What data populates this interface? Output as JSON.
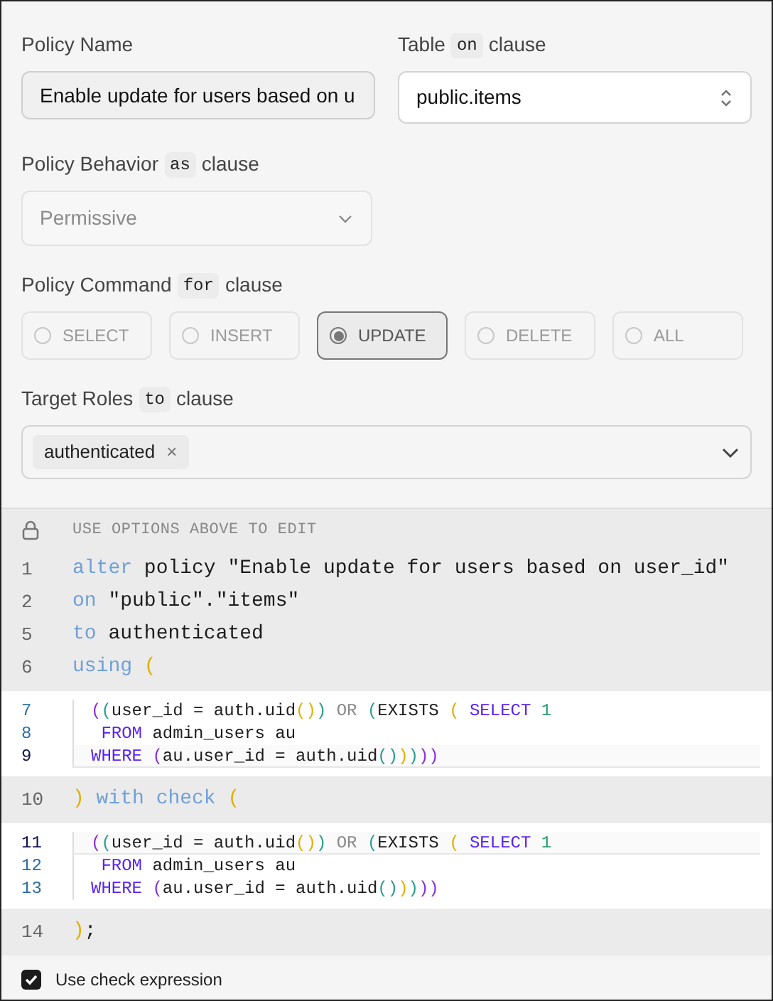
{
  "policy_name": {
    "label": "Policy Name",
    "value": "Enable update for users based on u"
  },
  "table": {
    "label": "Table",
    "keyword": "on",
    "suffix": "clause",
    "value": "public.items"
  },
  "behavior": {
    "label": "Policy Behavior",
    "keyword": "as",
    "suffix": "clause",
    "value": "Permissive",
    "disabled": true
  },
  "command": {
    "label": "Policy Command",
    "keyword": "for",
    "suffix": "clause",
    "options": [
      {
        "label": "SELECT",
        "selected": false
      },
      {
        "label": "INSERT",
        "selected": false
      },
      {
        "label": "UPDATE",
        "selected": true
      },
      {
        "label": "DELETE",
        "selected": false
      },
      {
        "label": "ALL",
        "selected": false
      }
    ]
  },
  "roles": {
    "label": "Target Roles",
    "keyword": "to",
    "suffix": "clause",
    "tags": [
      "authenticated"
    ],
    "remove": "×"
  },
  "editor": {
    "notice": "USE OPTIONS ABOVE TO EDIT",
    "blocks": [
      {
        "kind": "locked",
        "lines": [
          {
            "number": "1",
            "tokens": [
              {
                "text": "alter",
                "kind": "keyword"
              },
              {
                "text": " policy \"Enable update for users based on user_id\"",
                "kind": "plain"
              }
            ]
          },
          {
            "number": "2",
            "tokens": [
              {
                "text": "on",
                "kind": "keyword"
              },
              {
                "text": " \"public\".\"items\"",
                "kind": "plain"
              }
            ]
          },
          {
            "number": "5",
            "tokens": [
              {
                "text": "to",
                "kind": "keyword"
              },
              {
                "text": " authenticated",
                "kind": "plain"
              }
            ]
          },
          {
            "number": "6",
            "tokens": [
              {
                "text": "using",
                "kind": "keyword"
              },
              {
                "text": " (",
                "kind": "bracket3"
              }
            ]
          }
        ]
      },
      {
        "kind": "editable",
        "lines": [
          {
            "number": "7",
            "active": false,
            "tokens": [
              {
                "text": "(",
                "kind": "bracket1"
              },
              {
                "text": "(",
                "kind": "bracket2"
              },
              {
                "text": "user_id = auth.uid",
                "kind": "plain"
              },
              {
                "text": "()",
                "kind": "bracket3"
              },
              {
                "text": ")",
                "kind": "bracket2"
              },
              {
                "text": " OR ",
                "kind": "operator"
              },
              {
                "text": "(",
                "kind": "bracket2"
              },
              {
                "text": "EXISTS ",
                "kind": "plain"
              },
              {
                "text": "( ",
                "kind": "bracket3"
              },
              {
                "text": "SELECT ",
                "kind": "sqlkeyword"
              },
              {
                "text": "1",
                "kind": "number"
              }
            ]
          },
          {
            "number": "8",
            "active": false,
            "tokens": [
              {
                "text": " FROM",
                "kind": "sqlkeyword"
              },
              {
                "text": " admin_users au",
                "kind": "plain"
              }
            ]
          },
          {
            "number": "9",
            "active": true,
            "tokens": [
              {
                "text": "WHERE ",
                "kind": "sqlkeyword"
              },
              {
                "text": "(",
                "kind": "bracket1"
              },
              {
                "text": "au.user_id = auth.uid",
                "kind": "plain"
              },
              {
                "text": "()",
                "kind": "bracket2"
              },
              {
                "text": ")",
                "kind": "bracket3"
              },
              {
                "text": ")",
                "kind": "bracket2"
              },
              {
                "text": ")",
                "kind": "bracket1"
              },
              {
                "text": ")",
                "kind": "bracket1"
              }
            ]
          }
        ]
      },
      {
        "kind": "locked",
        "lines": [
          {
            "number": "10",
            "tokens": [
              {
                "text": ")",
                "kind": "bracket3"
              },
              {
                "text": " with check ",
                "kind": "keyword"
              },
              {
                "text": "(",
                "kind": "bracket3"
              }
            ]
          }
        ]
      },
      {
        "kind": "editable",
        "lines": [
          {
            "number": "11",
            "active": true,
            "tokens": [
              {
                "text": "(",
                "kind": "bracket1"
              },
              {
                "text": "(",
                "kind": "bracket2"
              },
              {
                "text": "user_id = auth.uid",
                "kind": "plain"
              },
              {
                "text": "()",
                "kind": "bracket3"
              },
              {
                "text": ")",
                "kind": "bracket2"
              },
              {
                "text": " OR ",
                "kind": "operator"
              },
              {
                "text": "(",
                "kind": "bracket2"
              },
              {
                "text": "EXISTS ",
                "kind": "plain"
              },
              {
                "text": "( ",
                "kind": "bracket3"
              },
              {
                "text": "SELECT ",
                "kind": "sqlkeyword"
              },
              {
                "text": "1",
                "kind": "number"
              }
            ]
          },
          {
            "number": "12",
            "active": false,
            "tokens": [
              {
                "text": " FROM",
                "kind": "sqlkeyword"
              },
              {
                "text": " admin_users au",
                "kind": "plain"
              }
            ]
          },
          {
            "number": "13",
            "active": false,
            "tokens": [
              {
                "text": "WHERE ",
                "kind": "sqlkeyword"
              },
              {
                "text": "(",
                "kind": "bracket1"
              },
              {
                "text": "au.user_id = auth.uid",
                "kind": "plain"
              },
              {
                "text": "()",
                "kind": "bracket2"
              },
              {
                "text": ")",
                "kind": "bracket3"
              },
              {
                "text": ")",
                "kind": "bracket2"
              },
              {
                "text": ")",
                "kind": "bracket1"
              },
              {
                "text": ")",
                "kind": "bracket1"
              }
            ]
          }
        ]
      },
      {
        "kind": "locked",
        "lines": [
          {
            "number": "14",
            "tokens": [
              {
                "text": ")",
                "kind": "bracket3"
              },
              {
                "text": ";",
                "kind": "plain"
              }
            ]
          }
        ]
      }
    ]
  },
  "check_expression": {
    "label": "Use check expression",
    "checked": true
  }
}
